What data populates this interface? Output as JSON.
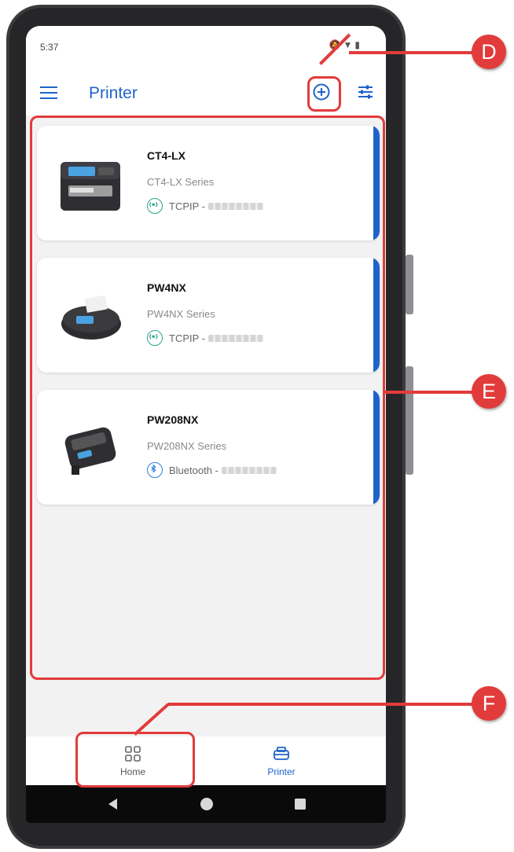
{
  "status_bar": {
    "time": "5:37",
    "icons": [
      "bell-off-icon",
      "wifi-icon",
      "battery-icon"
    ]
  },
  "app_bar": {
    "title": "Printer",
    "menu_icon": "menu-icon",
    "add_icon": "add-circle-icon",
    "filter_icon": "tune-icon"
  },
  "printers": [
    {
      "name": "CT4-LX",
      "series": "CT4-LX Series",
      "connection": "TCPIP -",
      "connection_type": "tcpip"
    },
    {
      "name": "PW4NX",
      "series": "PW4NX Series",
      "connection": "TCPIP -",
      "connection_type": "tcpip"
    },
    {
      "name": "PW208NX",
      "series": "PW208NX Series",
      "connection": "Bluetooth -",
      "connection_type": "bluetooth"
    }
  ],
  "bottom_nav": {
    "home": {
      "label": "Home",
      "icon": "grid-icon"
    },
    "printer": {
      "label": "Printer",
      "icon": "printer-icon"
    }
  },
  "system_nav": {
    "back": "back-icon",
    "home": "home-circle-icon",
    "recents": "recents-icon"
  },
  "callouts": {
    "d": "D",
    "e": "E",
    "f": "F"
  },
  "colors": {
    "accent": "#1e63c9",
    "callout": "#e23b3b",
    "tcpip": "#27a889",
    "bluetooth": "#2e7de1"
  }
}
